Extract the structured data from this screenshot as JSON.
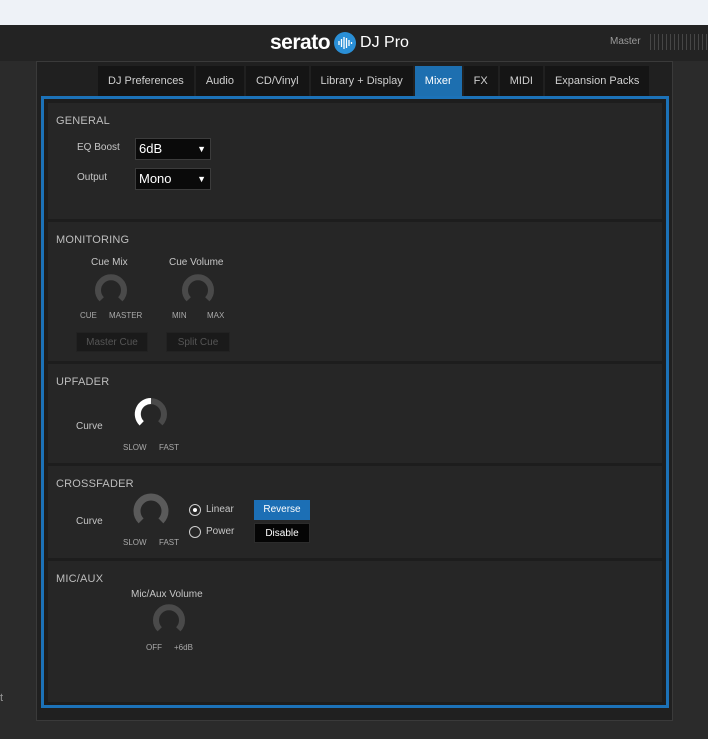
{
  "header": {
    "logo_word": "serato",
    "logo_product": "DJ Pro",
    "master_label": "Master"
  },
  "left_edge_char": "t",
  "tabs": [
    {
      "label": "DJ Preferences",
      "active": false
    },
    {
      "label": "Audio",
      "active": false
    },
    {
      "label": "CD/Vinyl",
      "active": false
    },
    {
      "label": "Library + Display",
      "active": false
    },
    {
      "label": "Mixer",
      "active": true
    },
    {
      "label": "FX",
      "active": false
    },
    {
      "label": "MIDI",
      "active": false
    },
    {
      "label": "Expansion Packs",
      "active": false
    }
  ],
  "general": {
    "title": "GENERAL",
    "eq_boost_label": "EQ Boost",
    "eq_boost_value": "6dB",
    "output_label": "Output",
    "output_value": "Mono"
  },
  "monitoring": {
    "title": "MONITORING",
    "cue_mix_label": "Cue Mix",
    "cue_mix_min": "CUE",
    "cue_mix_max": "MASTER",
    "cue_volume_label": "Cue Volume",
    "cue_volume_min": "MIN",
    "cue_volume_max": "MAX",
    "master_cue_button": "Master Cue",
    "split_cue_button": "Split Cue"
  },
  "upfader": {
    "title": "UPFADER",
    "curve_label": "Curve",
    "min_label": "SLOW",
    "max_label": "FAST"
  },
  "crossfader": {
    "title": "CROSSFADER",
    "curve_label": "Curve",
    "min_label": "SLOW",
    "max_label": "FAST",
    "radio_linear": "Linear",
    "radio_power": "Power",
    "selected": "Linear",
    "reverse_button": "Reverse",
    "disable_button": "Disable"
  },
  "mic_aux": {
    "title": "MIC/AUX",
    "volume_label": "Mic/Aux Volume",
    "min_label": "OFF",
    "max_label": "+6dB"
  },
  "colors": {
    "accent": "#1c72b8",
    "background": "#262626"
  }
}
